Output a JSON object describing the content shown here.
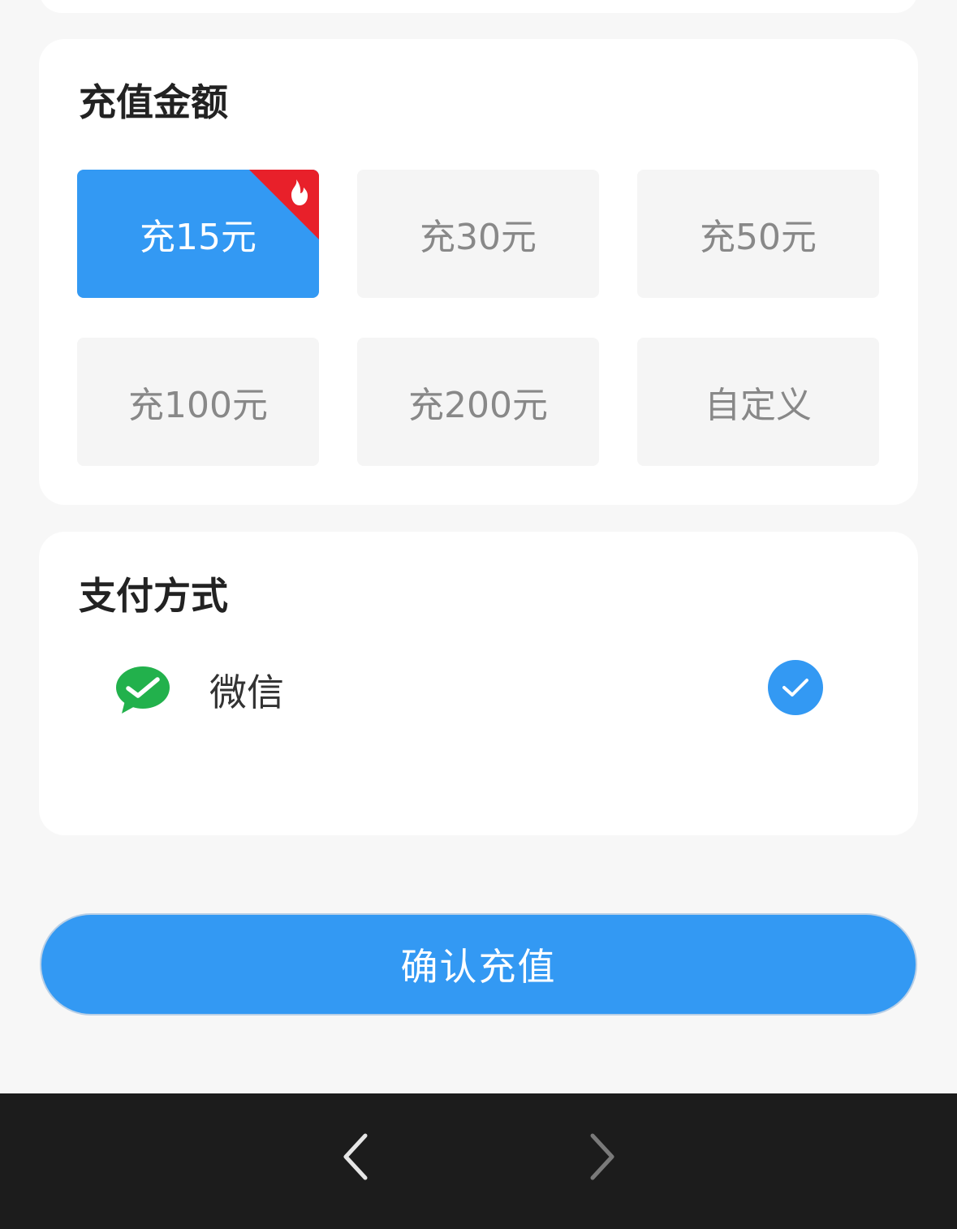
{
  "recharge": {
    "title": "充值金额",
    "options": [
      {
        "label": "充15元",
        "selected": true,
        "badge": "hot"
      },
      {
        "label": "充30元",
        "selected": false
      },
      {
        "label": "充50元",
        "selected": false
      },
      {
        "label": "充100元",
        "selected": false
      },
      {
        "label": "充200元",
        "selected": false
      },
      {
        "label": "自定义",
        "selected": false
      }
    ]
  },
  "payment": {
    "title": "支付方式",
    "methods": [
      {
        "label": "微信",
        "icon": "wechat-icon",
        "checked": true
      }
    ]
  },
  "confirm": {
    "label": "确认充值"
  },
  "colors": {
    "accent": "#3399f3",
    "badge_red": "#e8202a",
    "wechat_green": "#22b14c",
    "option_bg": "#f5f5f5",
    "page_bg": "#f7f7f7",
    "nav_bg": "#1c1c1c"
  },
  "nav": {
    "back_icon": "chevron-left-icon",
    "forward_icon": "chevron-right-icon"
  }
}
